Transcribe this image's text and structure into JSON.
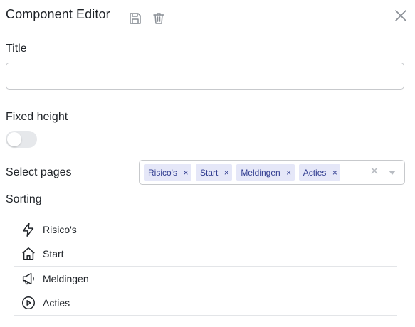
{
  "header": {
    "title": "Component Editor",
    "icons": [
      "save-icon",
      "trash-icon",
      "close-icon"
    ]
  },
  "form": {
    "title_label": "Title",
    "title_value": "",
    "fixed_height_label": "Fixed height",
    "fixed_height_on": false,
    "select_pages_label": "Select pages",
    "selected_pages": [
      "Risico's",
      "Start",
      "Meldingen",
      "Acties"
    ],
    "chip_remove_glyph": "×",
    "clear_glyph": "✕",
    "sorting_label": "Sorting"
  },
  "sorting": [
    {
      "label": "Risico's",
      "icon": "lightning-icon"
    },
    {
      "label": "Start",
      "icon": "home-icon"
    },
    {
      "label": "Meldingen",
      "icon": "megaphone-icon"
    },
    {
      "label": "Acties",
      "icon": "play-circle-icon"
    }
  ],
  "colors": {
    "chip_bg": "#e5e7f8",
    "chip_text": "#2f3b8f",
    "toggle_off": "#e6e8eb"
  }
}
